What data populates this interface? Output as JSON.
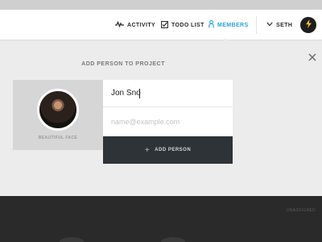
{
  "nav": {
    "activity_label": "ACTIVITY",
    "todo_label": "TODO LIST",
    "members_label": "MEMBERS",
    "user_label": "SETH",
    "active_color": "#2aa1dc"
  },
  "panel": {
    "title": "ADD PERSON TO PROJECT",
    "photo_caption": "BEAUTIFUL FACE",
    "name_value": "Jon Sno",
    "email_placeholder": "name@example.com",
    "add_button_label": "ADD PERSON"
  },
  "footer": {
    "partial_text": "UNASSIGNED"
  }
}
